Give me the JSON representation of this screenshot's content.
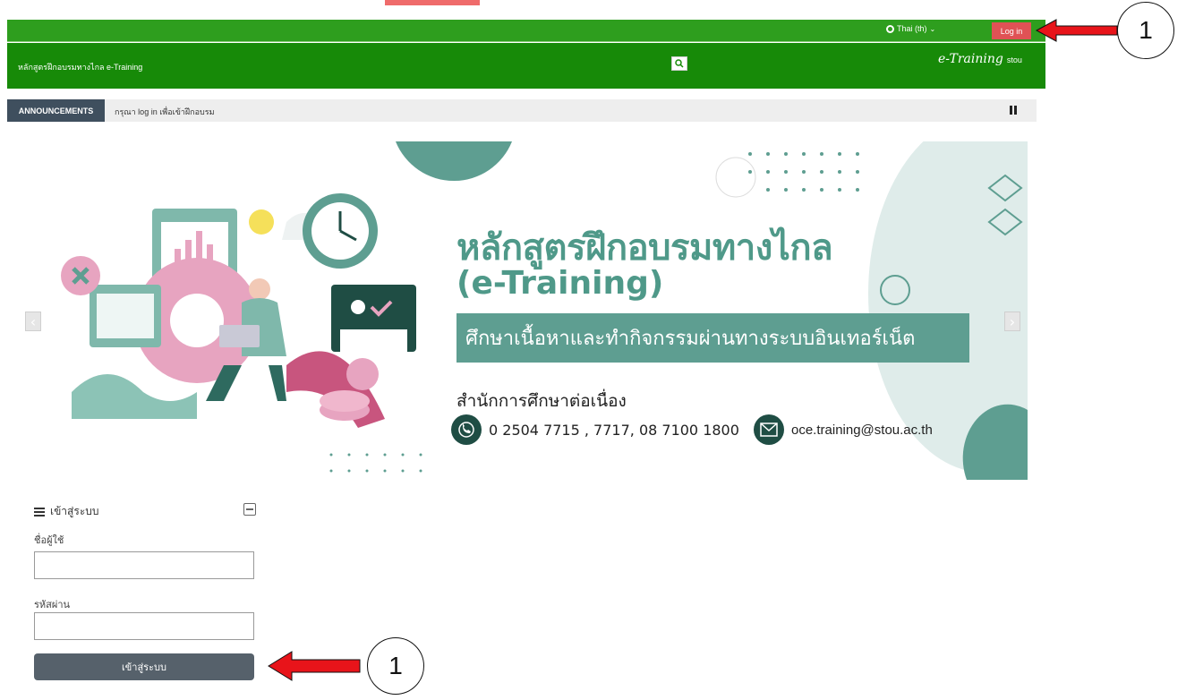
{
  "document": {
    "caption_fragment": "ผู้",
    "caption_fragment2": "ผู้"
  },
  "topbar": {
    "language": "Thai (th)",
    "login_button": "Log in"
  },
  "navbar": {
    "site_name": "หลักสูตรฝึกอบรมทางไกล e-Training",
    "logo_text": "e-Training",
    "logo_suffix": "stou"
  },
  "announcements": {
    "label": "ANNOUNCEMENTS",
    "text": "กรุณา log in เพื่อเข้าฝึกอบรม"
  },
  "banner": {
    "title": "หลักสูตรฝึกอบรมทางไกล",
    "subtitle": "(e-Training)",
    "bar_text": "ศึกษาเนื้อหาและทำกิจกรรมผ่านทางระบบอินเทอร์เน็ต",
    "office": "สำนักการศึกษาต่อเนื่อง",
    "phone": "0 2504 7715 , 7717, 08 7100 1800",
    "email": "oce.training@stou.ac.th",
    "accent_color": "#5e9e91"
  },
  "login_block": {
    "title": "เข้าสู่ระบบ",
    "username_label": "ชื่อผู้ใช้",
    "username_value": "",
    "password_label": "รหัสผ่าน",
    "password_value": "",
    "submit_label": "เข้าสู่ระบบ"
  },
  "annotations": {
    "callout_top": "1",
    "callout_bottom": "1"
  },
  "colors": {
    "topbar": "#2e9e1e",
    "navbar": "#178a08",
    "login_button": "#e05255",
    "announce_label": "#3f4f5e",
    "submit_button": "#56616b",
    "arrow": "#e8141a"
  }
}
